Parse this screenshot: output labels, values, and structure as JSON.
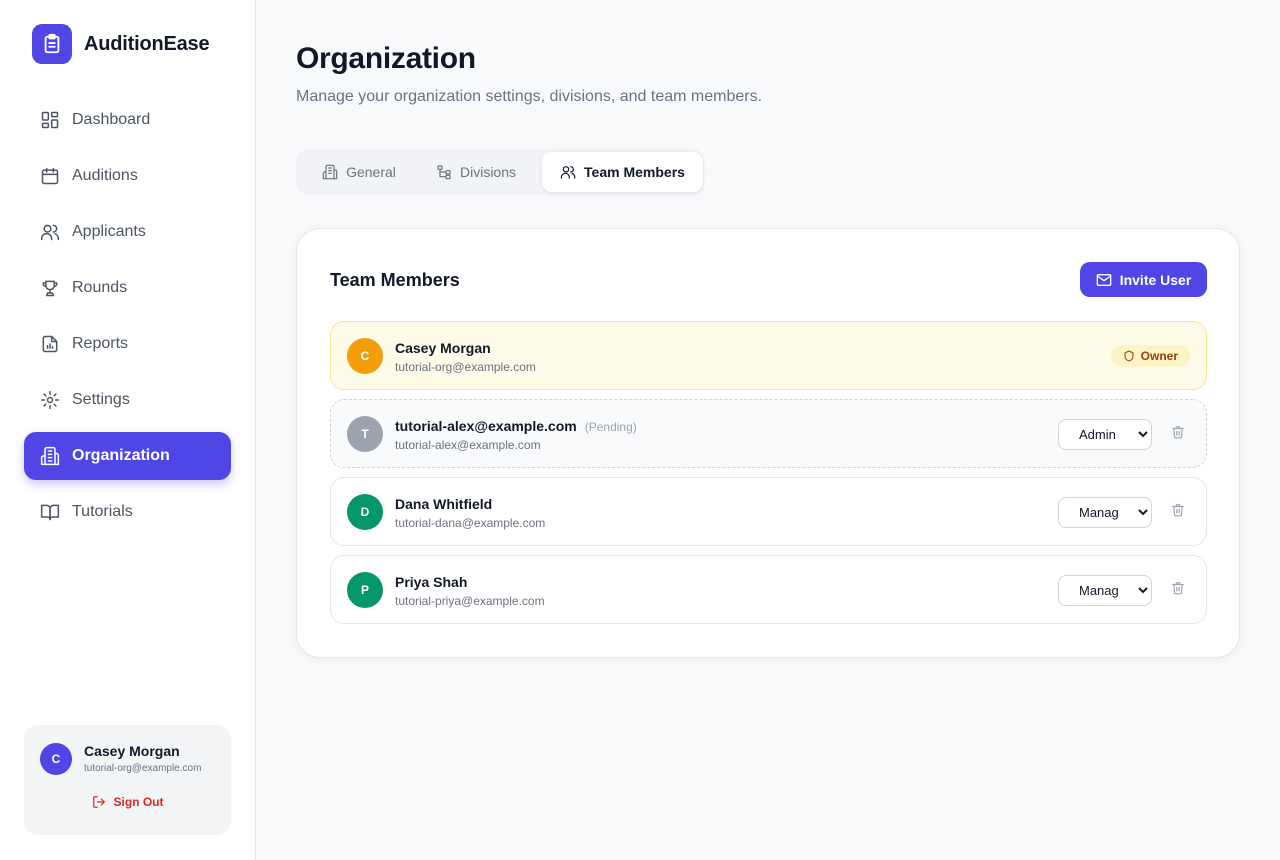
{
  "app": {
    "name": "AuditionEase"
  },
  "sidebar": {
    "items": [
      {
        "label": "Dashboard",
        "icon": "grid-icon"
      },
      {
        "label": "Auditions",
        "icon": "calendar-icon"
      },
      {
        "label": "Applicants",
        "icon": "users-icon"
      },
      {
        "label": "Rounds",
        "icon": "trophy-icon"
      },
      {
        "label": "Reports",
        "icon": "report-icon"
      },
      {
        "label": "Settings",
        "icon": "gear-icon"
      },
      {
        "label": "Organization",
        "icon": "building-icon",
        "active": true
      },
      {
        "label": "Tutorials",
        "icon": "book-icon"
      }
    ],
    "user": {
      "initial": "C",
      "name": "Casey Morgan",
      "email": "tutorial-org@example.com",
      "signout_label": "Sign Out"
    }
  },
  "page": {
    "title": "Organization",
    "subtitle": "Manage your organization settings, divisions, and team members."
  },
  "tabs": [
    {
      "label": "General"
    },
    {
      "label": "Divisions"
    },
    {
      "label": "Team Members",
      "active": true
    }
  ],
  "team": {
    "title": "Team Members",
    "invite_label": "Invite User",
    "members": [
      {
        "initial": "C",
        "name": "Casey Morgan",
        "email": "tutorial-org@example.com",
        "badge": "Owner",
        "avatar_color": "#f59e0b"
      },
      {
        "initial": "T",
        "name": "tutorial-alex@example.com",
        "pending_label": "(Pending)",
        "email": "tutorial-alex@example.com",
        "role": "Admin",
        "avatar_color": "#9ca3af"
      },
      {
        "initial": "D",
        "name": "Dana Whitfield",
        "email": "tutorial-dana@example.com",
        "role": "Manager",
        "avatar_color": "#059669"
      },
      {
        "initial": "P",
        "name": "Priya Shah",
        "email": "tutorial-priya@example.com",
        "role": "Manager",
        "avatar_color": "#059669"
      }
    ],
    "role_options": [
      "Admin",
      "Manager"
    ]
  },
  "colors": {
    "accent": "#4f46e5",
    "owner_bg": "#fefce8",
    "danger": "#dc2626"
  }
}
